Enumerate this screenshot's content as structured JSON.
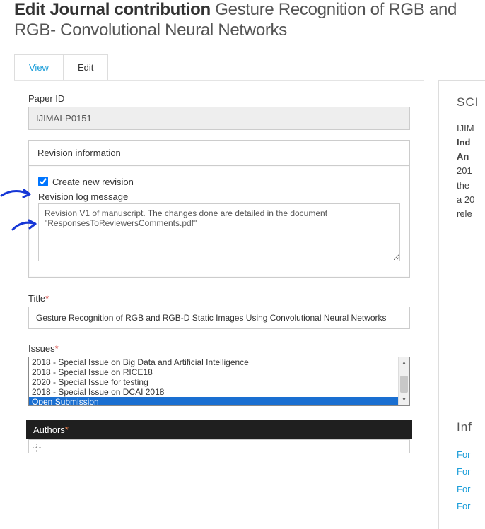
{
  "heading_bold": "Edit Journal contribution",
  "heading_rest": " Gesture Recognition of RGB and RGB- Convolutional Neural Networks",
  "tabs": {
    "view": "View",
    "edit": "Edit"
  },
  "paper_id": {
    "label": "Paper ID",
    "value": "IJIMAI-P0151"
  },
  "revision": {
    "legend": "Revision information",
    "checkbox_label": "Create new revision",
    "log_label": "Revision log message",
    "log_value": "Revision V1 of manuscript. The changes done are detailed in the document \"ResponsesToReviewersComments.pdf\""
  },
  "title": {
    "label": "Title",
    "value": "Gesture Recognition of RGB and RGB-D Static Images Using Convolutional Neural Networks"
  },
  "issues": {
    "label": "Issues",
    "options": [
      "2018 - Special Issue on Big Data and Artificial Intelligence",
      "2018 - Special Issue on RICE18",
      "2020 - Special Issue for testing",
      "2018 - Special Issue on DCAI 2018",
      "Open Submission"
    ],
    "selected_index": 4
  },
  "authors": {
    "label": "Authors"
  },
  "sidebar": {
    "sci_heading": "SCI",
    "sci_lines": [
      "IJIM",
      "Ind",
      "An",
      "201",
      "the",
      "a 20",
      "rele"
    ],
    "info_heading": "Inf",
    "info_links": [
      "For",
      "For",
      "For",
      "For"
    ]
  }
}
